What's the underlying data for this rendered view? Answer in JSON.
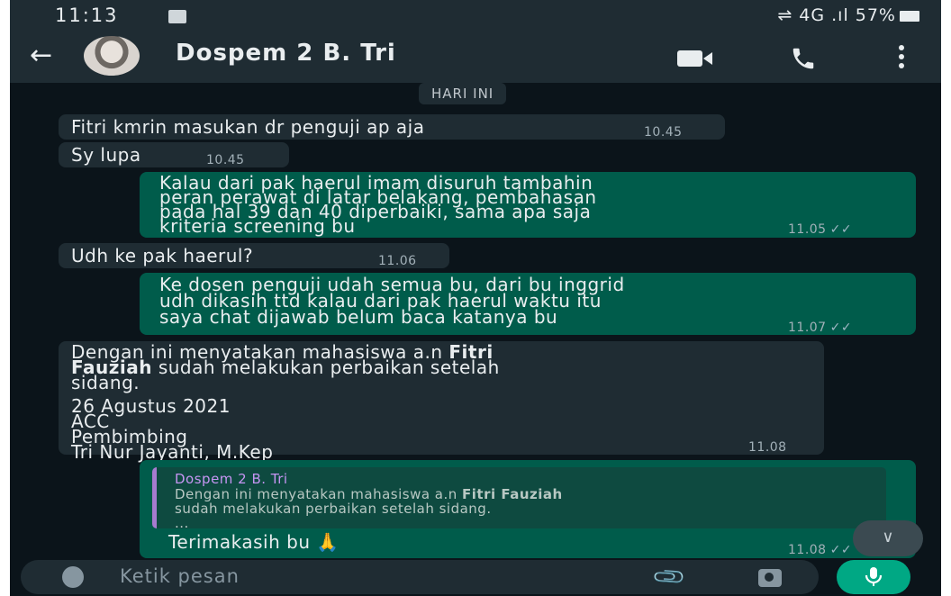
{
  "status": {
    "time": "11:13",
    "right": "⇌ 4G .ıl 57%"
  },
  "header": {
    "title": "Dospem 2 B. Tri"
  },
  "chat": {
    "date_chip": "HARI INI",
    "messages": [
      {
        "dir": "in",
        "text": "Fitri kmrin masukan dr penguji ap aja",
        "time": "10.45"
      },
      {
        "dir": "in",
        "text": "Sy lupa",
        "time": "10.45"
      },
      {
        "dir": "out",
        "lines": [
          "Kalau dari pak haerul imam disuruh tambahin",
          "peran perawat di latar belakang, pembahasan",
          "pada hal 39 dan 40 diperbaiki, sama apa saja",
          "kriteria screening bu"
        ],
        "time": "11.05"
      },
      {
        "dir": "in",
        "text": "Udh ke pak haerul?",
        "time": "11.06"
      },
      {
        "dir": "out",
        "lines": [
          "Ke dosen penguji udah semua bu, dari bu inggrid",
          "udh dikasih ttd kalau dari pak haerul waktu itu",
          "saya chat dijawab belum baca katanya bu"
        ],
        "time": "11.07"
      },
      {
        "dir": "in",
        "line1": "Dengan ini menyatakan mahasiswa a.n ",
        "line1_bold": "Fitri",
        "line2_bold": "Fauziah",
        "line2": " sudah melakukan perbaikan setelah",
        "line3": "sidang.",
        "line4": "26 Agustus 2021",
        "line5": "ACC",
        "line6": "Pembimbing",
        "line7": "Tri Nur Jayanti, M.Kep",
        "time": "11.08"
      },
      {
        "dir": "out",
        "quote_name": "Dospem 2 B. Tri",
        "quote_line1": "Dengan ini menyatakan mahasiswa a.n ",
        "quote_line1_bold": "Fitri Fauziah",
        "quote_line2": "sudah melakukan perbaikan setelah sidang.",
        "quote_line3": "...",
        "text": "Terimakasih bu 🙏",
        "time": "11.08"
      }
    ]
  },
  "input": {
    "placeholder": "Ketik pesan"
  },
  "icons": {
    "back": "arrow-left-icon",
    "video": "video-call-icon",
    "call": "phone-icon",
    "menu": "more-vert-icon",
    "emoji": "emoji-icon",
    "attach": "paperclip-icon",
    "camera": "camera-icon",
    "mic": "microphone-icon",
    "scroll": "chevron-double-down-icon"
  },
  "colors": {
    "header": "#1f2c33",
    "chat_bg": "#0b141a",
    "incoming": "#1f2c33",
    "outgoing": "#005c4b",
    "accent": "#00a884"
  }
}
